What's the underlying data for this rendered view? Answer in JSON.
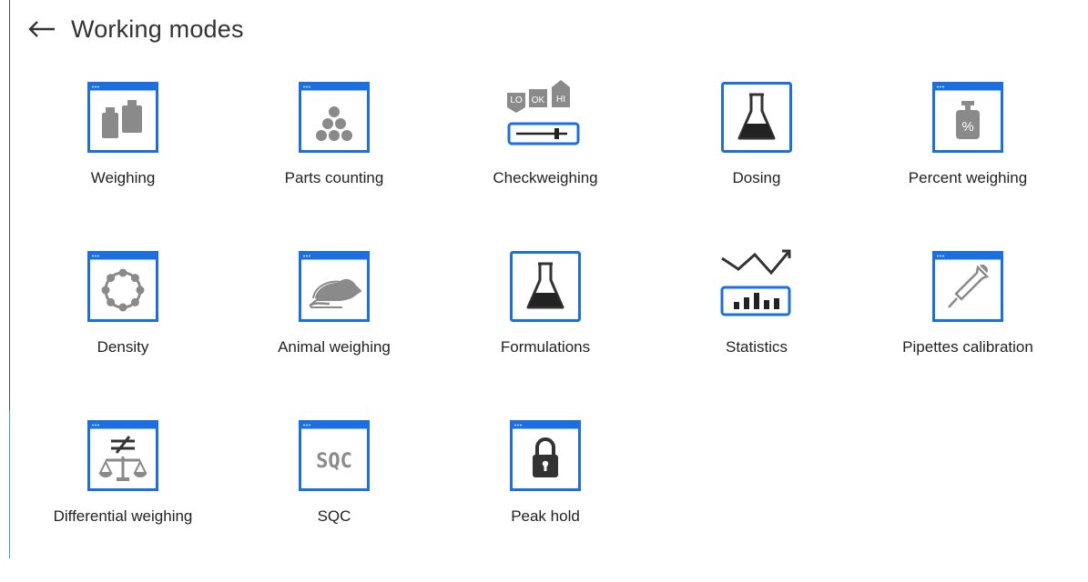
{
  "header": {
    "title": "Working modes",
    "back_icon": "arrow-left-icon"
  },
  "colors": {
    "accent": "#1b6fe0",
    "icon_gray": "#8a8a8a",
    "text": "#222222"
  },
  "modes": [
    {
      "label": "Weighing",
      "icon": "weights-icon"
    },
    {
      "label": "Parts counting",
      "icon": "parts-dots-icon"
    },
    {
      "label": "Checkweighing",
      "icon": "checkweighing-icon"
    },
    {
      "label": "Dosing",
      "icon": "flask-icon"
    },
    {
      "label": "Percent weighing",
      "icon": "percent-weight-icon"
    },
    {
      "label": "Density",
      "icon": "density-ring-icon"
    },
    {
      "label": "Animal weighing",
      "icon": "rat-icon"
    },
    {
      "label": "Formulations",
      "icon": "flask-icon"
    },
    {
      "label": "Statistics",
      "icon": "statistics-icon"
    },
    {
      "label": "Pipettes calibration",
      "icon": "pipette-icon"
    },
    {
      "label": "Differential weighing",
      "icon": "differential-scale-icon"
    },
    {
      "label": "SQC",
      "icon": "sqc-icon"
    },
    {
      "label": "Peak hold",
      "icon": "padlock-icon"
    }
  ],
  "icon_texts": {
    "check_lo": "LO",
    "check_ok": "OK",
    "check_hi": "HI",
    "percent": "%",
    "sqc": "SQC"
  }
}
